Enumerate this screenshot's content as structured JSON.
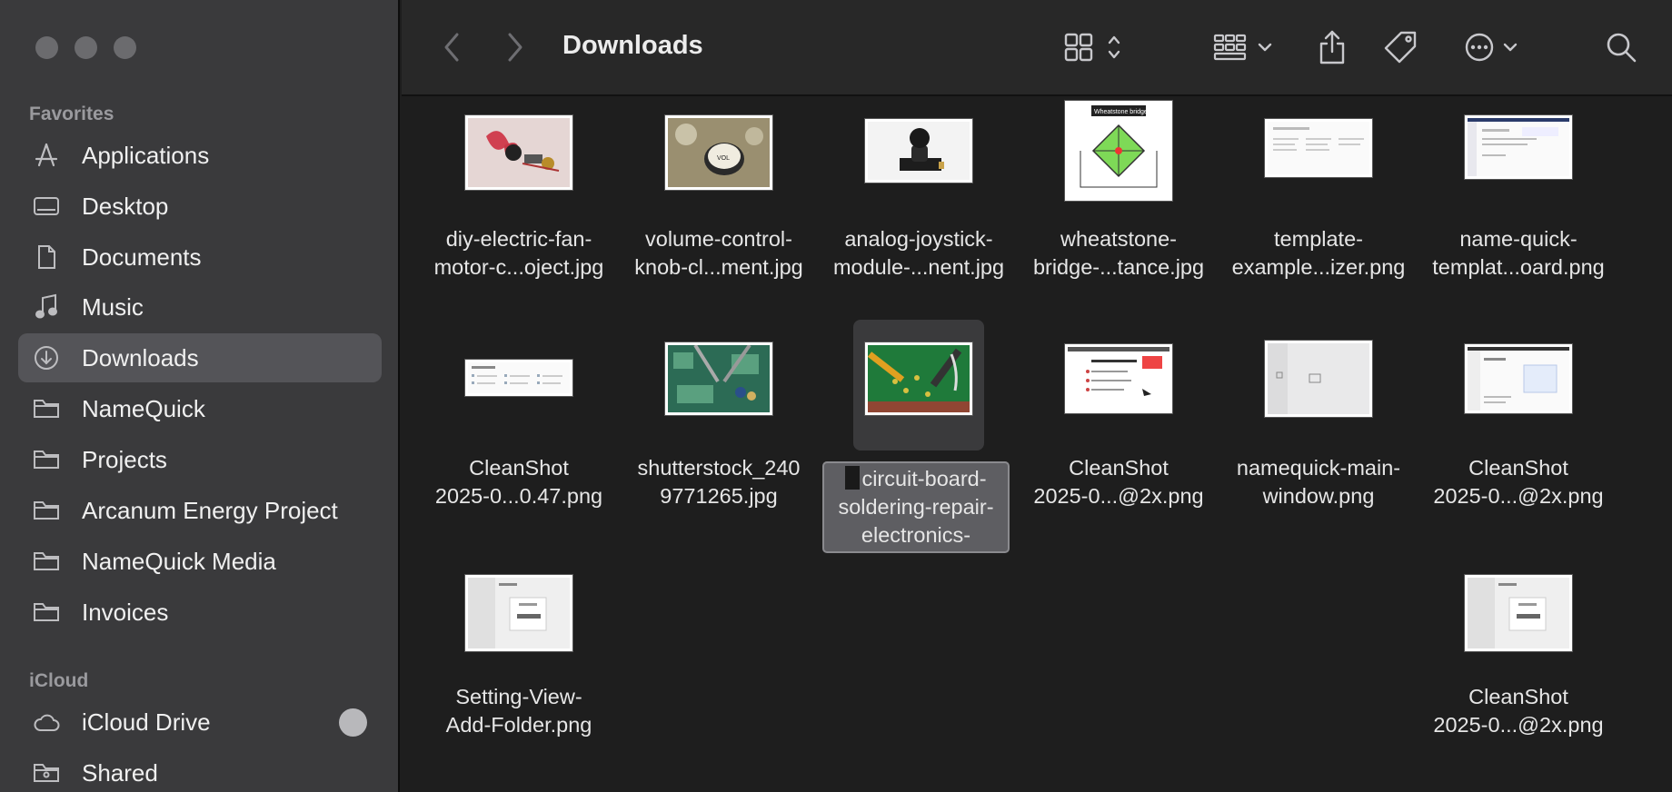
{
  "window": {
    "title": "Downloads"
  },
  "sidebar": {
    "favorites_label": "Favorites",
    "icloud_label": "iCloud",
    "favorites": [
      {
        "label": "Applications",
        "icon": "applications-icon"
      },
      {
        "label": "Desktop",
        "icon": "desktop-icon"
      },
      {
        "label": "Documents",
        "icon": "document-icon"
      },
      {
        "label": "Music",
        "icon": "music-icon"
      },
      {
        "label": "Downloads",
        "icon": "downloads-icon",
        "active": true
      },
      {
        "label": "NameQuick",
        "icon": "folder-icon"
      },
      {
        "label": "Projects",
        "icon": "folder-icon"
      },
      {
        "label": "Arcanum Energy Project",
        "icon": "folder-icon"
      },
      {
        "label": "NameQuick Media",
        "icon": "folder-icon"
      },
      {
        "label": "Invoices",
        "icon": "folder-icon"
      }
    ],
    "icloud": [
      {
        "label": "iCloud Drive",
        "icon": "cloud-icon"
      },
      {
        "label": "Shared",
        "icon": "shared-folder-icon"
      }
    ]
  },
  "files": [
    {
      "line1": "diy-electric-fan-",
      "line2": "motor-c...oject.jpg"
    },
    {
      "line1": "volume-control-",
      "line2": "knob-cl...ment.jpg"
    },
    {
      "line1": "analog-joystick-",
      "line2": "module-...nent.jpg"
    },
    {
      "line1": "wheatstone-",
      "line2": "bridge-...tance.jpg",
      "thumb_text": "Wheatstone bridge"
    },
    {
      "line1": "template-",
      "line2": "example...izer.png"
    },
    {
      "line1": "name-quick-",
      "line2": "templat...oard.png"
    },
    {
      "line1": "CleanShot",
      "line2": "2025-0...0.47.png"
    },
    {
      "line1": "shutterstock_240",
      "line2": "9771265.jpg"
    },
    {
      "line1": "circuit-board-",
      "line2": "soldering-repair-",
      "line3": "electronics-",
      "selected": true
    },
    {
      "line1": "CleanShot",
      "line2": "2025-0...@2x.png"
    },
    {
      "line1": "namequick-main-",
      "line2": "window.png"
    },
    {
      "line1": "CleanShot",
      "line2": "2025-0...@2x.png"
    },
    {
      "line1": "Setting-View-",
      "line2": "Add-Folder.png"
    },
    {
      "line1": "CleanShot",
      "line2": "2025-0...@2x.png"
    }
  ]
}
